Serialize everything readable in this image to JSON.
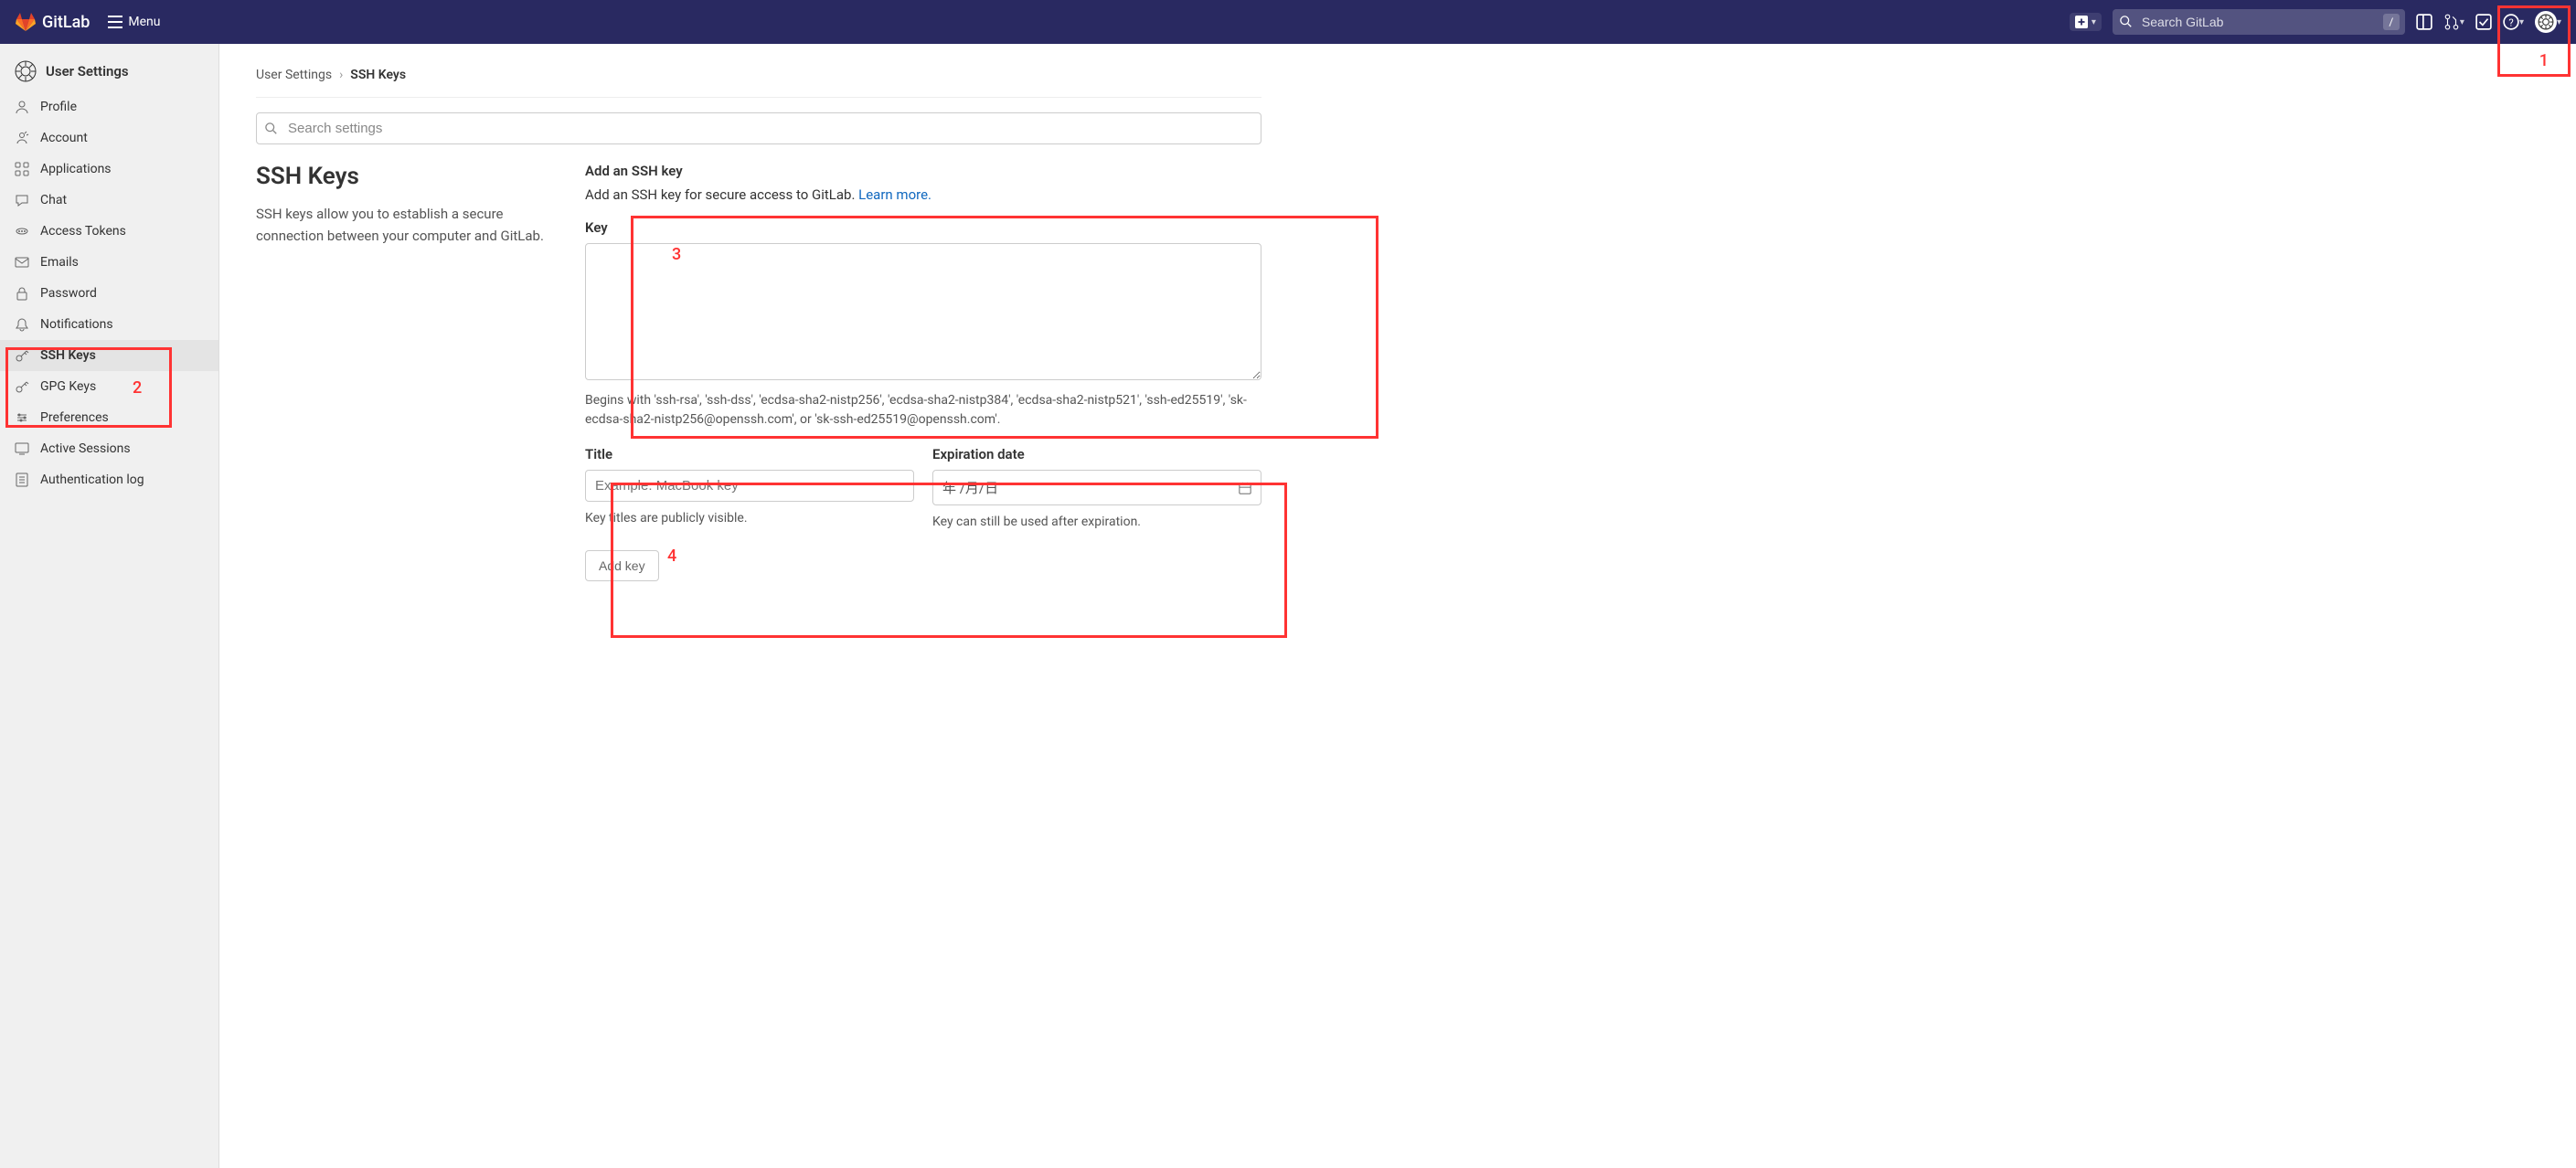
{
  "header": {
    "brand": "GitLab",
    "menu_label": "Menu",
    "search_placeholder": "Search GitLab",
    "search_shortcut": "/"
  },
  "sidebar": {
    "title": "User Settings",
    "items": [
      {
        "label": "Profile",
        "icon": "user"
      },
      {
        "label": "Account",
        "icon": "account"
      },
      {
        "label": "Applications",
        "icon": "apps"
      },
      {
        "label": "Chat",
        "icon": "chat"
      },
      {
        "label": "Access Tokens",
        "icon": "token"
      },
      {
        "label": "Emails",
        "icon": "email"
      },
      {
        "label": "Password",
        "icon": "lock"
      },
      {
        "label": "Notifications",
        "icon": "bell"
      },
      {
        "label": "SSH Keys",
        "icon": "key"
      },
      {
        "label": "GPG Keys",
        "icon": "key"
      },
      {
        "label": "Preferences",
        "icon": "pref"
      },
      {
        "label": "Active Sessions",
        "icon": "session"
      },
      {
        "label": "Authentication log",
        "icon": "log"
      }
    ],
    "active_index": 8
  },
  "breadcrumb": {
    "parent": "User Settings",
    "current": "SSH Keys"
  },
  "settings_search_placeholder": "Search settings",
  "page": {
    "heading": "SSH Keys",
    "description": "SSH keys allow you to establish a secure connection between your computer and GitLab."
  },
  "form": {
    "section_heading": "Add an SSH key",
    "section_sub_prefix": "Add an SSH key for secure access to GitLab. ",
    "section_sub_link": "Learn more.",
    "key_label": "Key",
    "key_help": "Begins with 'ssh-rsa', 'ssh-dss', 'ecdsa-sha2-nistp256', 'ecdsa-sha2-nistp384', 'ecdsa-sha2-nistp521', 'ssh-ed25519', 'sk-ecdsa-sha2-nistp256@openssh.com', or 'sk-ssh-ed25519@openssh.com'.",
    "title_label": "Title",
    "title_placeholder": "Example: MacBook key",
    "title_help": "Key titles are publicly visible.",
    "exp_label": "Expiration date",
    "exp_placeholder": "年 /月/日",
    "exp_help": "Key can still be used after expiration.",
    "add_button": "Add key"
  },
  "annotations": {
    "a1": "1",
    "a2": "2",
    "a3": "3",
    "a4": "4"
  }
}
